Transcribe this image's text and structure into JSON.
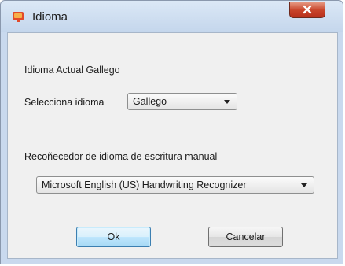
{
  "window": {
    "title": "Idioma",
    "icon": "app-icon",
    "close_icon": "close-icon"
  },
  "current_language": {
    "label": "Idioma Actual Gallego"
  },
  "language_select": {
    "label": "Selecciona idioma",
    "value": "Gallego"
  },
  "handwriting": {
    "label": "Recoñecedor de idioma de escritura manual",
    "value": "Microsoft English (US) Handwriting Recognizer"
  },
  "buttons": {
    "ok": "Ok",
    "cancel": "Cancelar"
  }
}
